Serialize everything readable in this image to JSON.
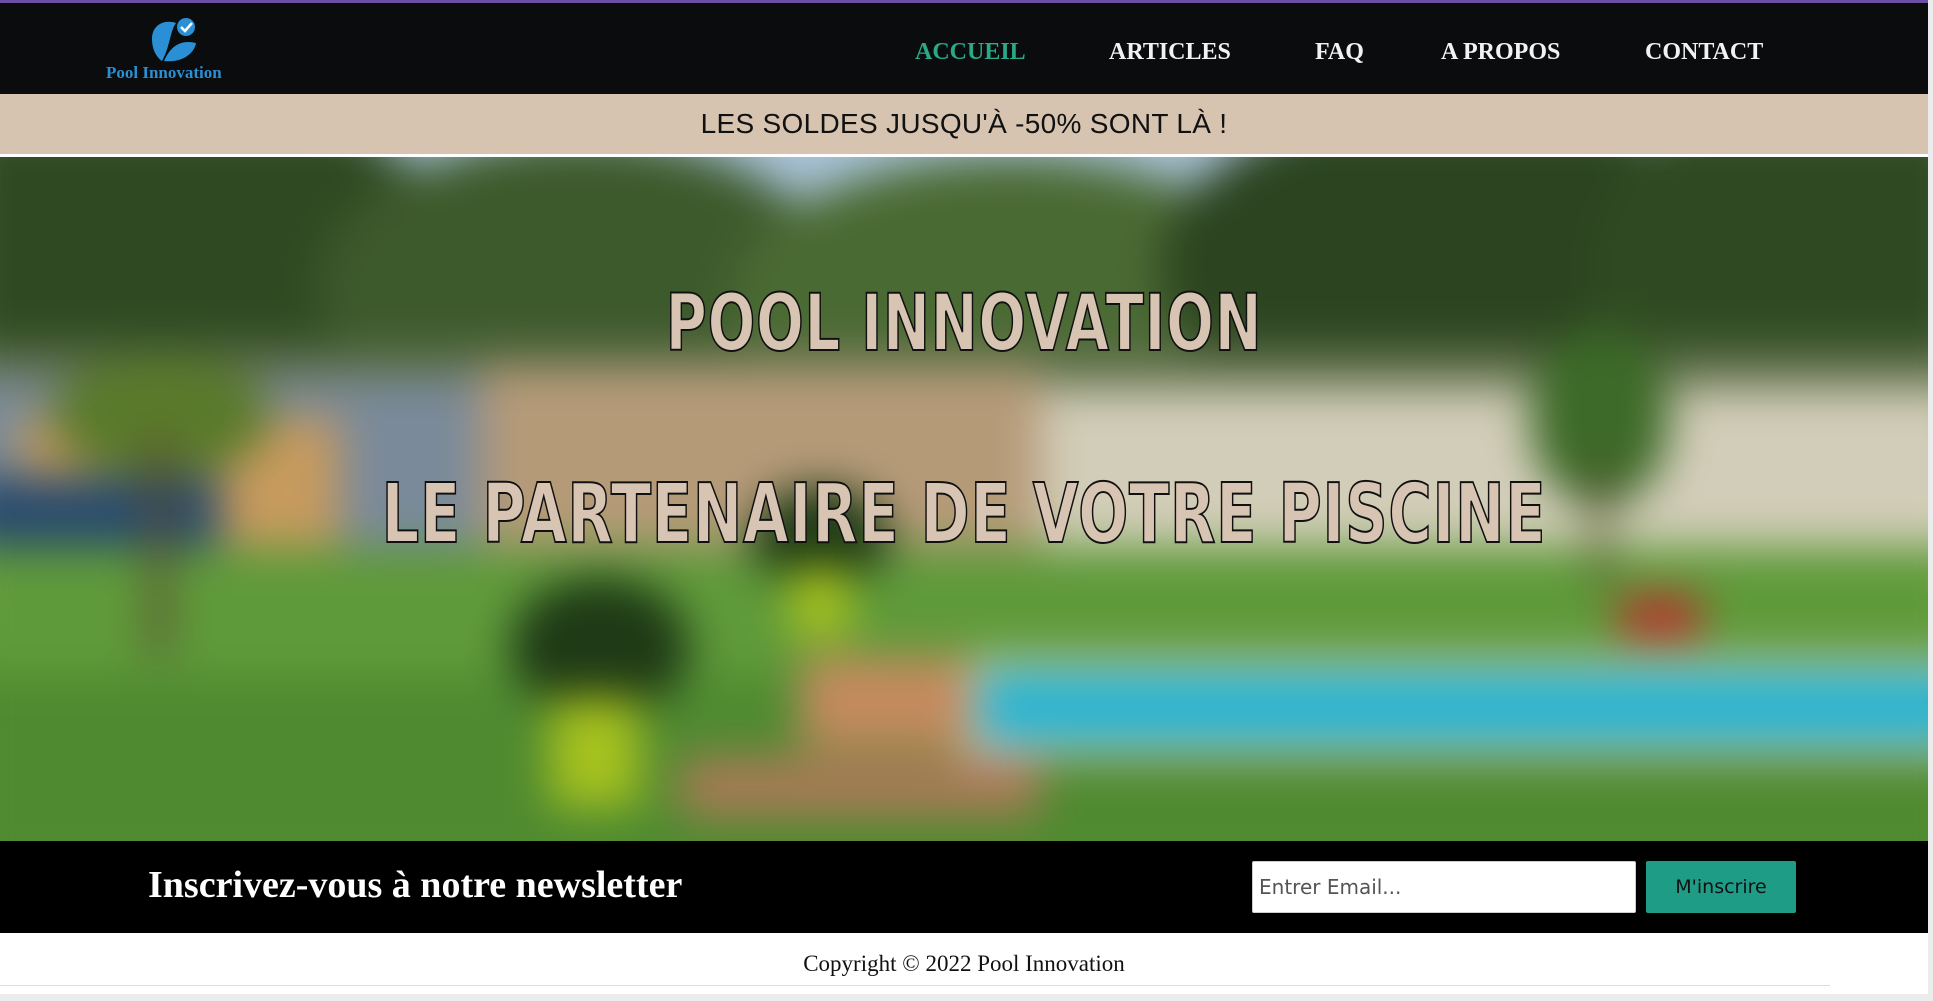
{
  "brand": {
    "name": "Pool Innovation",
    "color": "#2a8fd4",
    "icon": "leaves-check-logo-icon"
  },
  "nav": {
    "items": [
      {
        "label": "ACCUEIL",
        "active": true
      },
      {
        "label": "ARTICLES",
        "active": false
      },
      {
        "label": "FAQ",
        "active": false
      },
      {
        "label": "A PROPOS",
        "active": false
      },
      {
        "label": "CONTACT",
        "active": false
      }
    ],
    "active_color": "#2aa888"
  },
  "promo": {
    "text": "LES SOLDES JUSQU'À -50% SONT LÀ !",
    "background": "#d6c4b0"
  },
  "hero": {
    "title": "POOL INNOVATION",
    "subtitle": "LE PARTENAIRE DE VOTRE PISCINE",
    "text_color": "#d8c4b2"
  },
  "newsletter": {
    "title": "Inscrivez-vous à notre newsletter",
    "email_placeholder": "Entrer Email...",
    "email_value": "",
    "button_label": "M'inscrire",
    "button_color": "#1f9c86"
  },
  "footer": {
    "copyright": "Copyright © 2022 Pool Innovation"
  }
}
